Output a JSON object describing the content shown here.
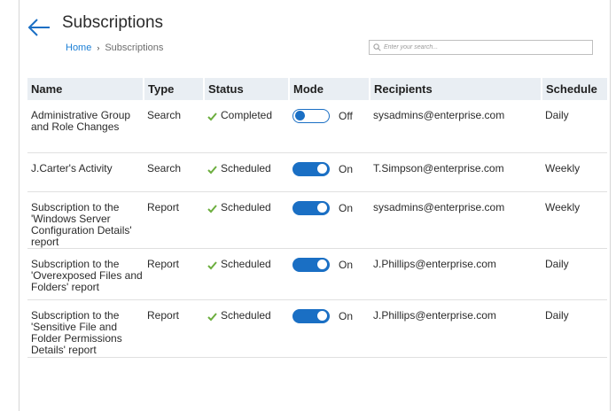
{
  "header": {
    "title": "Subscriptions",
    "breadcrumb": {
      "home": "Home",
      "current": "Subscriptions",
      "separator": "›"
    },
    "search_placeholder": "Enter your search..."
  },
  "colors": {
    "accent": "#1a6fc4",
    "check": "#6cae3e",
    "header_bg": "#e9eef3"
  },
  "icons": {
    "back": "arrow-left-icon",
    "search": "search-icon",
    "status": "check-icon"
  },
  "table": {
    "columns": [
      "Name",
      "Type",
      "Status",
      "Mode",
      "Recipients",
      "Schedule"
    ],
    "rows": [
      {
        "name": "Administrative Group and Role Changes",
        "type": "Search",
        "status": "Completed",
        "mode_on": false,
        "mode_label": "Off",
        "recipients": "sysadmins@enterprise.com",
        "schedule": "Daily"
      },
      {
        "name": "J.Carter's Activity",
        "type": "Search",
        "status": "Scheduled",
        "mode_on": true,
        "mode_label": "On",
        "recipients": "T.Simpson@enterprise.com",
        "schedule": "Weekly"
      },
      {
        "name": "Subscription to the 'Windows Server Configuration Details' report",
        "type": "Report",
        "status": "Scheduled",
        "mode_on": true,
        "mode_label": "On",
        "recipients": "sysadmins@enterprise.com",
        "schedule": "Weekly"
      },
      {
        "name": "Subscription to the 'Overexposed Files and Folders' report",
        "type": "Report",
        "status": "Scheduled",
        "mode_on": true,
        "mode_label": "On",
        "recipients": "J.Phillips@enterprise.com",
        "schedule": "Daily"
      },
      {
        "name": "Subscription to the 'Sensitive File and Folder Permissions Details' report",
        "type": "Report",
        "status": "Scheduled",
        "mode_on": true,
        "mode_label": "On",
        "recipients": "J.Phillips@enterprise.com",
        "schedule": "Daily"
      }
    ]
  }
}
